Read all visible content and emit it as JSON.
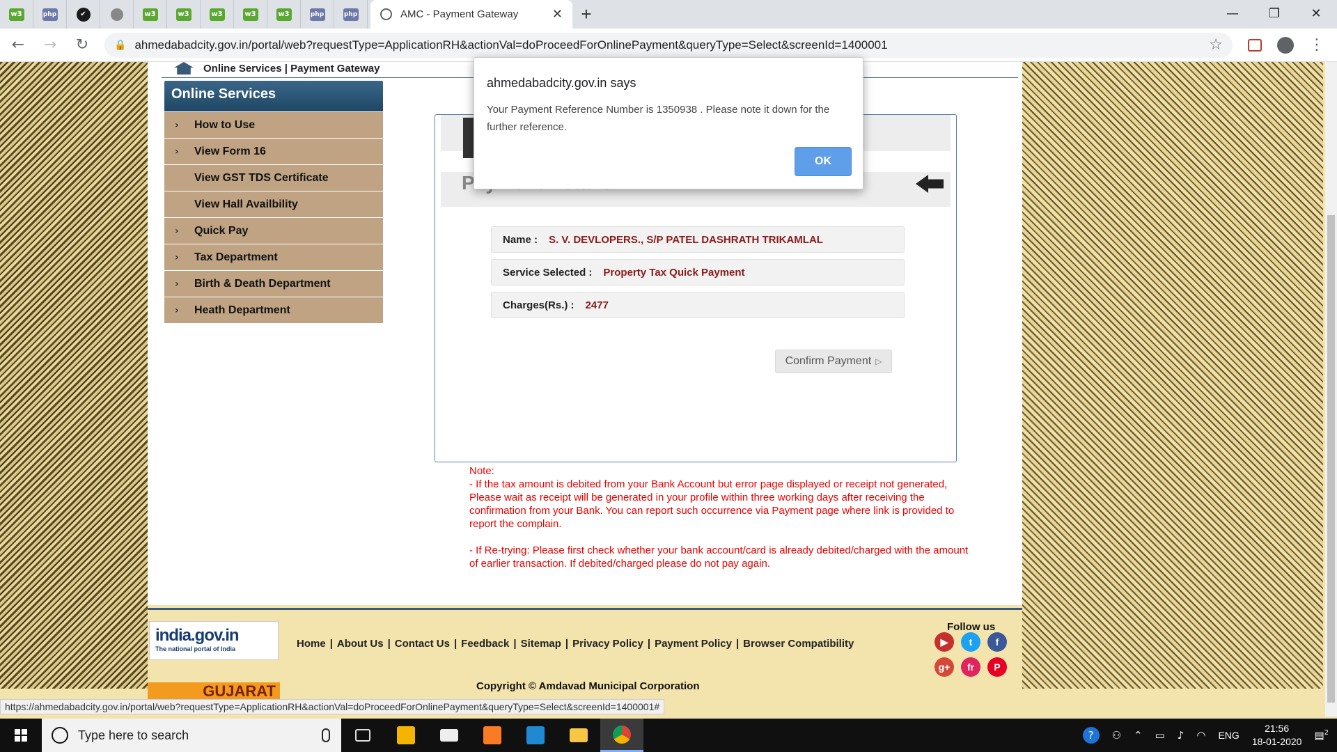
{
  "browser": {
    "active_tab_title": "AMC - Payment Gateway",
    "url": "ahmedabadcity.gov.in/portal/web?requestType=ApplicationRH&actionVal=doProceedForOnlinePayment&queryType=Select&screenId=1400001",
    "status_url": "https://ahmedabadcity.gov.in/portal/web?requestType=ApplicationRH&actionVal=doProceedForOnlinePayment&queryType=Select&screenId=1400001#",
    "pinned_tabs": [
      {
        "icon": "green-tab-icon",
        "text": "w3"
      },
      {
        "icon": "php-tab-icon",
        "text": "php"
      },
      {
        "icon": "check-tab-icon",
        "text": "✔"
      },
      {
        "icon": "globe-tab-icon",
        "text": ""
      },
      {
        "icon": "green-tab-icon",
        "text": "w3"
      },
      {
        "icon": "green-tab-icon",
        "text": "w3"
      },
      {
        "icon": "green-tab-icon",
        "text": "w3"
      },
      {
        "icon": "green-tab-icon",
        "text": "w3"
      },
      {
        "icon": "green-tab-icon",
        "text": "w3"
      },
      {
        "icon": "php-tab-icon",
        "text": "php"
      },
      {
        "icon": "php-tab-icon",
        "text": "php"
      }
    ]
  },
  "breadcrumb": "Online Services | Payment Gateway",
  "sidebar": {
    "title": "Online Services",
    "items": [
      {
        "label": "How to Use",
        "chevron": true
      },
      {
        "label": "View Form 16",
        "chevron": true
      },
      {
        "label": "View GST TDS Certificate",
        "chevron": false
      },
      {
        "label": "View Hall Availbility",
        "chevron": false
      },
      {
        "label": "Quick Pay",
        "chevron": true
      },
      {
        "label": "Tax Department",
        "chevron": true
      },
      {
        "label": "Birth & Death Department",
        "chevron": true
      },
      {
        "label": "Heath Department",
        "chevron": true
      }
    ]
  },
  "payment": {
    "title": "Payment Details",
    "name_label": "Name :",
    "name_value": "S. V. DEVLOPERS., S/P PATEL DASHRATH TRIKAMLAL",
    "service_label": "Service Selected :",
    "service_value": "Property Tax Quick Payment",
    "charges_label": "Charges(Rs.) :",
    "charges_value": "2477",
    "confirm_label": "Confirm Payment"
  },
  "note": {
    "heading": "Note:",
    "line1": "- If the tax amount is debited from your Bank Account but error page displayed or receipt not generated, Please wait as receipt will be generated in your profile within three working days after receiving the confirmation from your Bank. You can report such occurrence via Payment page where link is provided to report the complain.",
    "line2": "- If Re-trying: Please first check whether your bank account/card is already debited/charged with the amount of earlier transaction. If debited/charged please do not pay again."
  },
  "footer": {
    "india_logo_big": "india.gov.in",
    "india_logo_small": "The national portal of India",
    "gujarat": "GUJARAT",
    "links": [
      "Home",
      "About Us",
      "Contact Us",
      "Feedback",
      "Sitemap",
      "Privacy Policy",
      "Payment Policy",
      "Browser Compatibility"
    ],
    "follow_us": "Follow us",
    "copyright": "Copyright © Amdavad Municipal Corporation"
  },
  "dialog": {
    "title": "ahmedabadcity.gov.in says",
    "message": "Your Payment Reference Number is 1350938 . Please note it down for the further reference.",
    "ok_label": "OK"
  },
  "taskbar": {
    "search_placeholder": "Type here to search",
    "language": "ENG",
    "time": "21:56",
    "date": "18-01-2020",
    "notification_count": "2"
  },
  "colors": {
    "sidebar_header": "#1f4764",
    "sidebar_item": "#bfa383",
    "value_text": "#8b1a1a",
    "note_text": "#ee0000",
    "ok_button": "#5f9ee8"
  }
}
